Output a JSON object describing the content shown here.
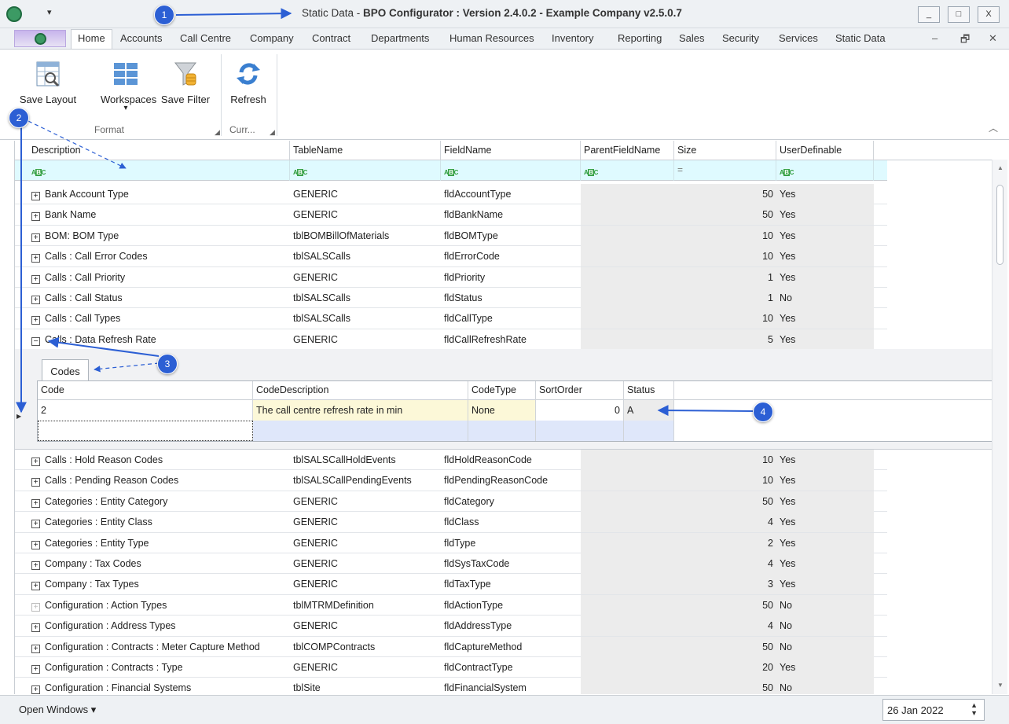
{
  "window": {
    "title_prefix": "Static Data - ",
    "title_bold": "BPO Configurator : Version 2.4.0.2 - Example Company v2.5.0.7",
    "quick_access": "▾",
    "minimize": "_",
    "maximize": "□",
    "close": "X"
  },
  "menu": {
    "tabs": [
      "Home",
      "Accounts",
      "Call Centre",
      "Company",
      "Contract",
      "Departments",
      "Human Resources",
      "Inventory",
      "Reporting",
      "Sales",
      "Security",
      "Services",
      "Static Data"
    ],
    "active": "Home",
    "mdi_minimize": "–",
    "mdi_restore": "🗗",
    "mdi_close": "✕"
  },
  "ribbon": {
    "save_layout": "Save Layout",
    "workspaces": "Workspaces",
    "workspaces_arrow": "▾",
    "save_filter": "Save Filter",
    "refresh": "Refresh",
    "group_format": "Format",
    "group_curr": "Curr...",
    "collapse": "︿"
  },
  "grid": {
    "columns": [
      "Description",
      "TableName",
      "FieldName",
      "ParentFieldName",
      "Size",
      "UserDefinable"
    ],
    "filter_eq": "=",
    "rows_top": [
      {
        "desc": "Bank Account Type",
        "table": "GENERIC",
        "field": "fldAccountType",
        "parent": "",
        "size": "50",
        "user": "Yes"
      },
      {
        "desc": "Bank Name",
        "table": "GENERIC",
        "field": "fldBankName",
        "parent": "",
        "size": "50",
        "user": "Yes"
      },
      {
        "desc": "BOM: BOM Type",
        "table": "tblBOMBillOfMaterials",
        "field": "fldBOMType",
        "parent": "",
        "size": "10",
        "user": "Yes"
      },
      {
        "desc": "Calls : Call Error Codes",
        "table": "tblSALSCalls",
        "field": "fldErrorCode",
        "parent": "",
        "size": "10",
        "user": "Yes"
      },
      {
        "desc": "Calls : Call Priority",
        "table": "GENERIC",
        "field": "fldPriority",
        "parent": "",
        "size": "1",
        "user": "Yes"
      },
      {
        "desc": "Calls : Call Status",
        "table": "tblSALSCalls",
        "field": "fldStatus",
        "parent": "",
        "size": "1",
        "user": "No"
      },
      {
        "desc": "Calls : Call Types",
        "table": "tblSALSCalls",
        "field": "fldCallType",
        "parent": "",
        "size": "10",
        "user": "Yes"
      },
      {
        "desc": "Calls : Data Refresh Rate",
        "table": "GENERIC",
        "field": "fldCallRefreshRate",
        "parent": "",
        "size": "5",
        "user": "Yes"
      }
    ],
    "rows_bottom": [
      {
        "desc": "Calls : Hold Reason Codes",
        "table": "tblSALSCallHoldEvents",
        "field": "fldHoldReasonCode",
        "parent": "",
        "size": "10",
        "user": "Yes"
      },
      {
        "desc": "Calls : Pending Reason Codes",
        "table": "tblSALSCallPendingEvents",
        "field": "fldPendingReasonCode",
        "parent": "",
        "size": "10",
        "user": "Yes"
      },
      {
        "desc": "Categories : Entity Category",
        "table": "GENERIC",
        "field": "fldCategory",
        "parent": "",
        "size": "50",
        "user": "Yes"
      },
      {
        "desc": "Categories : Entity Class",
        "table": "GENERIC",
        "field": "fldClass",
        "parent": "",
        "size": "4",
        "user": "Yes"
      },
      {
        "desc": "Categories : Entity Type",
        "table": "GENERIC",
        "field": "fldType",
        "parent": "",
        "size": "2",
        "user": "Yes"
      },
      {
        "desc": "Company : Tax Codes",
        "table": "GENERIC",
        "field": "fldSysTaxCode",
        "parent": "",
        "size": "4",
        "user": "Yes"
      },
      {
        "desc": "Company : Tax Types",
        "table": "GENERIC",
        "field": "fldTaxType",
        "parent": "",
        "size": "3",
        "user": "Yes"
      },
      {
        "desc": "Configuration : Action Types",
        "table": "tblMTRMDefinition",
        "field": "fldActionType",
        "parent": "",
        "size": "50",
        "user": "No"
      },
      {
        "desc": "Configuration : Address Types",
        "table": "GENERIC",
        "field": "fldAddressType",
        "parent": "",
        "size": "4",
        "user": "No"
      },
      {
        "desc": "Configuration : Contracts : Meter Capture Method",
        "table": "tblCOMPContracts",
        "field": "fldCaptureMethod",
        "parent": "",
        "size": "50",
        "user": "No"
      },
      {
        "desc": "Configuration : Contracts : Type",
        "table": "GENERIC",
        "field": "fldContractType",
        "parent": "",
        "size": "20",
        "user": "Yes"
      },
      {
        "desc": "Configuration : Financial Systems",
        "table": "tblSite",
        "field": "fldFinancialSystem",
        "parent": "",
        "size": "50",
        "user": "No"
      }
    ]
  },
  "detail": {
    "tab": "Codes",
    "columns": [
      "Code",
      "CodeDescription",
      "CodeType",
      "SortOrder",
      "Status"
    ],
    "row": {
      "code": "2",
      "description": "The call centre refresh rate in min",
      "type": "None",
      "sort": "0",
      "status": "A"
    }
  },
  "status": {
    "open_windows": "Open Windows ▾",
    "date": "26 Jan 2022"
  },
  "annotations": [
    "1",
    "2",
    "3",
    "4"
  ],
  "colors": {
    "accent": "#2c5fd4",
    "filter_row": "#dffaff",
    "editing": "#fcf8d8"
  }
}
